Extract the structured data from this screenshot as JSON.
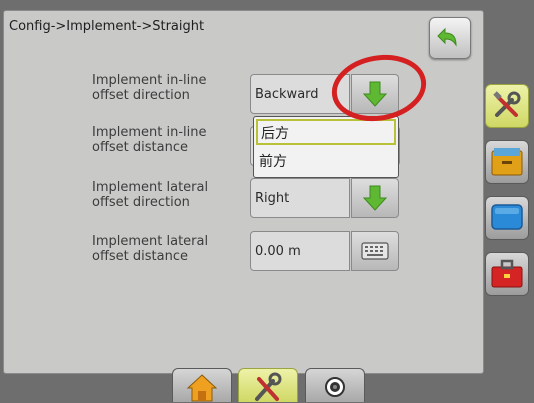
{
  "header": {
    "breadcrumb": "Config->Implement->Straight"
  },
  "rows": [
    {
      "label_line1": "Implement in-line",
      "label_line2": "offset direction",
      "value": "Backward",
      "control": "arrow-down-icon"
    },
    {
      "label_line1": "Implement in-line",
      "label_line2": "offset distance",
      "value": "",
      "control": ""
    },
    {
      "label_line1": "Implement lateral",
      "label_line2": "offset direction",
      "value": "Right",
      "control": "arrow-down-icon"
    },
    {
      "label_line1": "Implement lateral",
      "label_line2": "offset distance",
      "value": "0.00 m",
      "control": "keyboard-icon"
    }
  ],
  "dropdown": {
    "options": [
      "后方",
      "前方"
    ],
    "selected_index": 0
  },
  "sidebar": {
    "items": [
      "tools-icon",
      "folder-icon",
      "display-icon",
      "toolbox-icon"
    ],
    "active_index": 0
  },
  "bottom_tabs": {
    "items": [
      "home-icon",
      "tools-icon",
      "gps-icon"
    ],
    "active_index": 1
  },
  "colors": {
    "accent_green": "#5fb832",
    "highlight": "#cfd865",
    "annotation_red": "#d42020"
  }
}
